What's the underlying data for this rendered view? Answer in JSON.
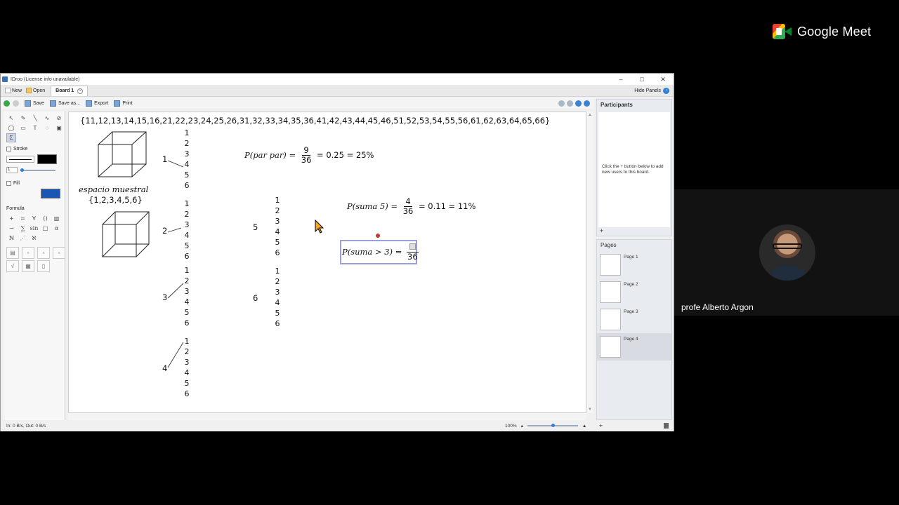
{
  "meet": {
    "brand": "Google Meet",
    "participant_name": "profe Alberto Argon"
  },
  "window": {
    "title": "IDroo (License info unavailable)",
    "controls": {
      "minimize": "–",
      "maximize": "□",
      "close": "✕"
    }
  },
  "menubar": {
    "new": "New",
    "open": "Open",
    "tab": "Board 1",
    "hide_panels": "Hide Panels"
  },
  "toolbar": {
    "save": "Save",
    "save_as": "Save as...",
    "export": "Export",
    "print": "Print"
  },
  "left_panel": {
    "stroke": "Stroke",
    "fill": "Fill",
    "formula": "Formula",
    "stroke_width": "1",
    "stroke_color": "#000000",
    "fill_color": "#1a56b3"
  },
  "canvas": {
    "sample_set": "{11,12,13,14,15,16,21,22,23,24,25,26,31,32,33,34,35,36,41,42,43,44,45,46,51,52,53,54,55,56,61,62,63,64,65,66}",
    "espacio_label": "espacio muestral",
    "espacio_set": "{1,2,3,4,5,6}",
    "die_values": [
      "1",
      "2",
      "3",
      "4",
      "5",
      "6"
    ],
    "branch_labels": [
      "1",
      "2",
      "3",
      "4",
      "5",
      "6"
    ],
    "formula1": {
      "lhs": "P(par par) =",
      "num": "9",
      "den": "36",
      "rhs": "= 0.25 = 25%"
    },
    "formula2": {
      "lhs": "P(suma 5) =",
      "num": "4",
      "den": "36",
      "rhs": "= 0.11 = 11%"
    },
    "formula3": {
      "lhs": "P(suma > 3) =",
      "den": "36"
    }
  },
  "participants": {
    "title": "Participants",
    "hint": "Click the + button below to add new users to this board.",
    "add": "+"
  },
  "pages": {
    "title": "Pages",
    "items": [
      "Page 1",
      "Page 2",
      "Page 3",
      "Page 4"
    ]
  },
  "status": {
    "traffic": "In: 0 B/s, Out: 0 B/s",
    "zoom": "100%",
    "add": "+"
  }
}
